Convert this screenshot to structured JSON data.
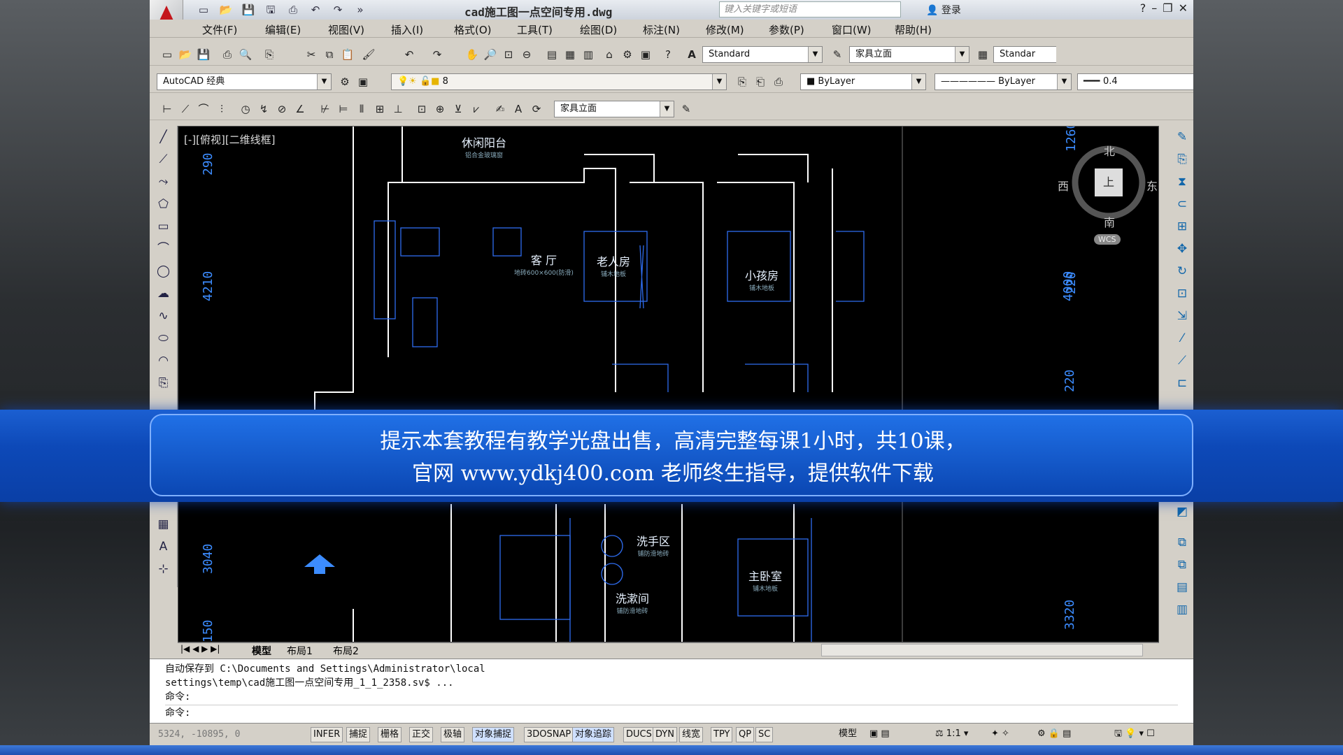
{
  "title_bar": {
    "doc_title": "cad施工图一点空间专用.dwg",
    "search_placeholder": "键入关键字或短语",
    "login_label": "登录",
    "help_icon": "?"
  },
  "menu": [
    "文件(F)",
    "编辑(E)",
    "视图(V)",
    "插入(I)",
    "格式(O)",
    "工具(T)",
    "绘图(D)",
    "标注(N)",
    "修改(M)",
    "参数(P)",
    "窗口(W)",
    "帮助(H)"
  ],
  "toolbar": {
    "text_style": "Standard",
    "dim_style": "家具立面",
    "table_style": "Standar",
    "workspace": "AutoCAD 经典",
    "layer": "8",
    "color": "ByLayer",
    "linetype": "ByLayer",
    "lineweight": "0.4",
    "dim_style_2": "家具立面"
  },
  "viewport": {
    "label": "[-][俯视][二维线框]",
    "compass": {
      "north": "北",
      "south": "南",
      "east": "东",
      "west": "西",
      "top": "上",
      "wcs": "WCS"
    },
    "dims": [
      "290",
      "4210",
      "3040",
      "150",
      "1260",
      "4000",
      "220",
      "3320",
      "220"
    ],
    "rooms": [
      {
        "name": "休闲阳台",
        "sub": "铝合金玻璃窗"
      },
      {
        "name": "客 厅",
        "sub": "地砖600×600(防滑)"
      },
      {
        "name": "老人房",
        "sub": "铺木地板"
      },
      {
        "name": "小孩房",
        "sub": "铺木地板"
      },
      {
        "name": "洗手区",
        "sub": "铺防滑地砖"
      },
      {
        "name": "洗漱间",
        "sub": "铺防滑地砖"
      },
      {
        "name": "主卧室",
        "sub": "铺木地板"
      }
    ]
  },
  "layout_tabs": [
    "模型",
    "布局1",
    "布局2"
  ],
  "command": {
    "line1": "自动保存到 C:\\Documents and Settings\\Administrator\\local",
    "line2": "settings\\temp\\cad施工图一点空间专用_1_1_2358.sv$ ...",
    "line3": "命令:",
    "prompt": "命令:"
  },
  "status": {
    "coords": "5324, -10895, 0",
    "toggles": [
      "INFER",
      "捕捉",
      "栅格",
      "正交",
      "极轴",
      "对象捕捉",
      "3DOSNAP",
      "对象追踪",
      "DUCS",
      "DYN",
      "线宽",
      "TPY",
      "QP",
      "SC"
    ],
    "model": "模型",
    "scale": "1:1"
  },
  "banner": {
    "line1": "提示本套教程有教学光盘出售，高清完整每课1小时，共10课，",
    "line2": "官网 www.ydkj400.com 老师终生指导，提供软件下载"
  },
  "colors": {
    "accent": "#1b5fd1",
    "canvas": "#000000",
    "line": "#3c8cff",
    "wall": "#ffffff"
  }
}
